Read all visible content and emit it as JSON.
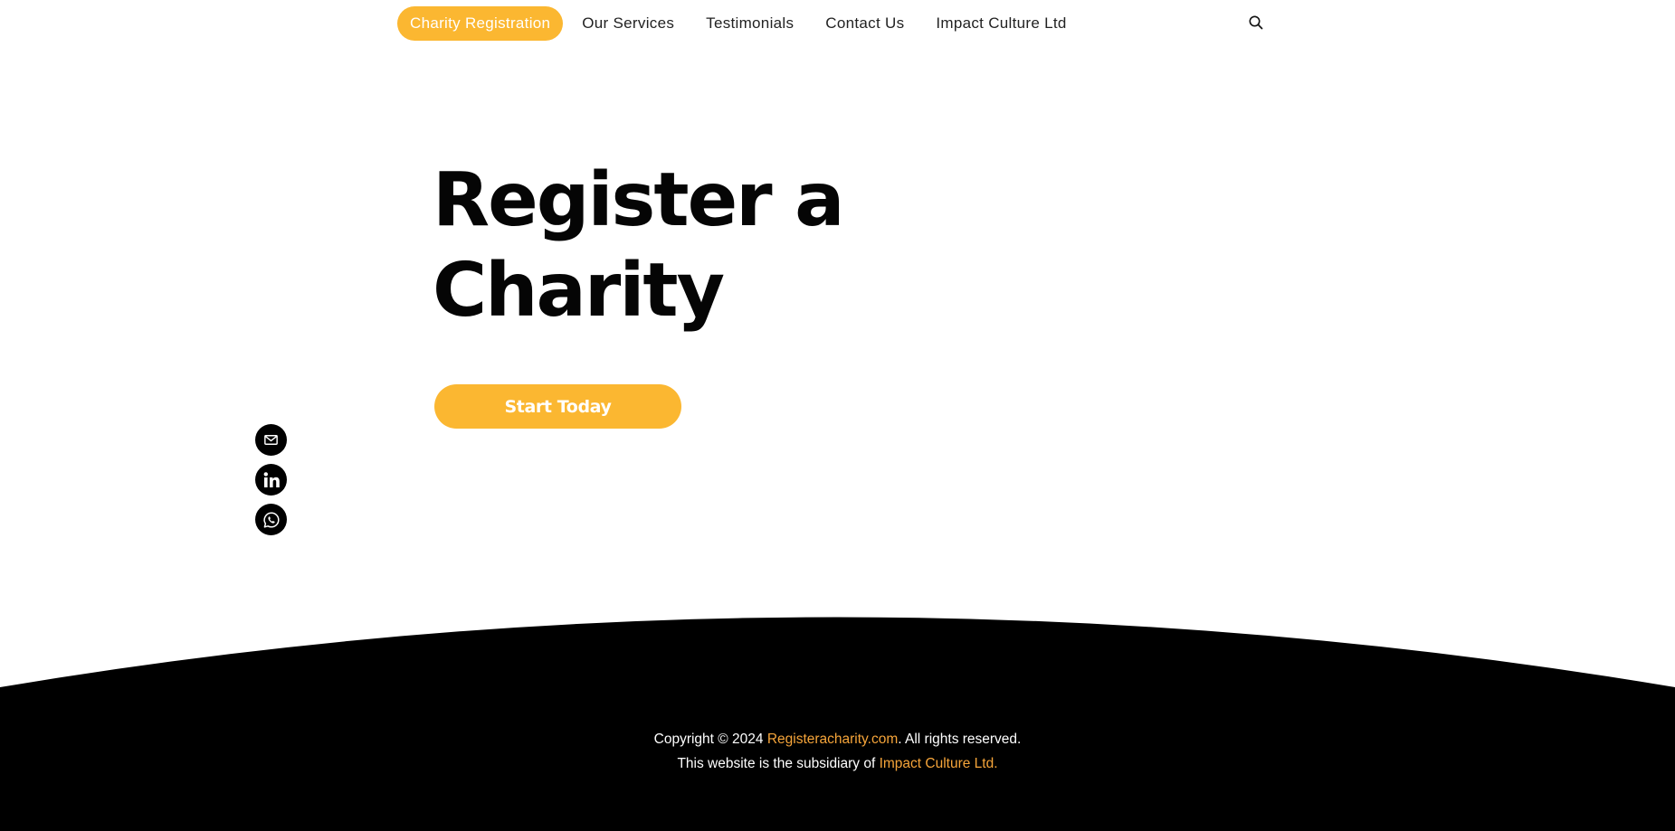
{
  "nav": {
    "items": [
      {
        "label": "Charity Registration",
        "active": true
      },
      {
        "label": "Our Services",
        "active": false
      },
      {
        "label": "Testimonials",
        "active": false
      },
      {
        "label": "Contact Us",
        "active": false
      },
      {
        "label": "Impact Culture Ltd",
        "active": false
      }
    ],
    "search_icon": "search-icon"
  },
  "hero": {
    "title_line1": "Register a",
    "title_line2": "Charity",
    "cta_label": "Start Today"
  },
  "social": {
    "icons": [
      "mail-icon",
      "linkedin-icon",
      "whatsapp-icon"
    ]
  },
  "footer": {
    "copyright_prefix": "Copyright © 2024 ",
    "site_link": "Registeracharity.com",
    "copyright_suffix": ". All rights reserved.",
    "subsidiary_prefix": "This website is the subsidiary of ",
    "company_link": "Impact Culture Ltd",
    "subsidiary_suffix": "."
  },
  "colors": {
    "accent": "#fbb731",
    "link": "#f6a53a",
    "footer_bg": "#000000",
    "text": "#050505"
  }
}
